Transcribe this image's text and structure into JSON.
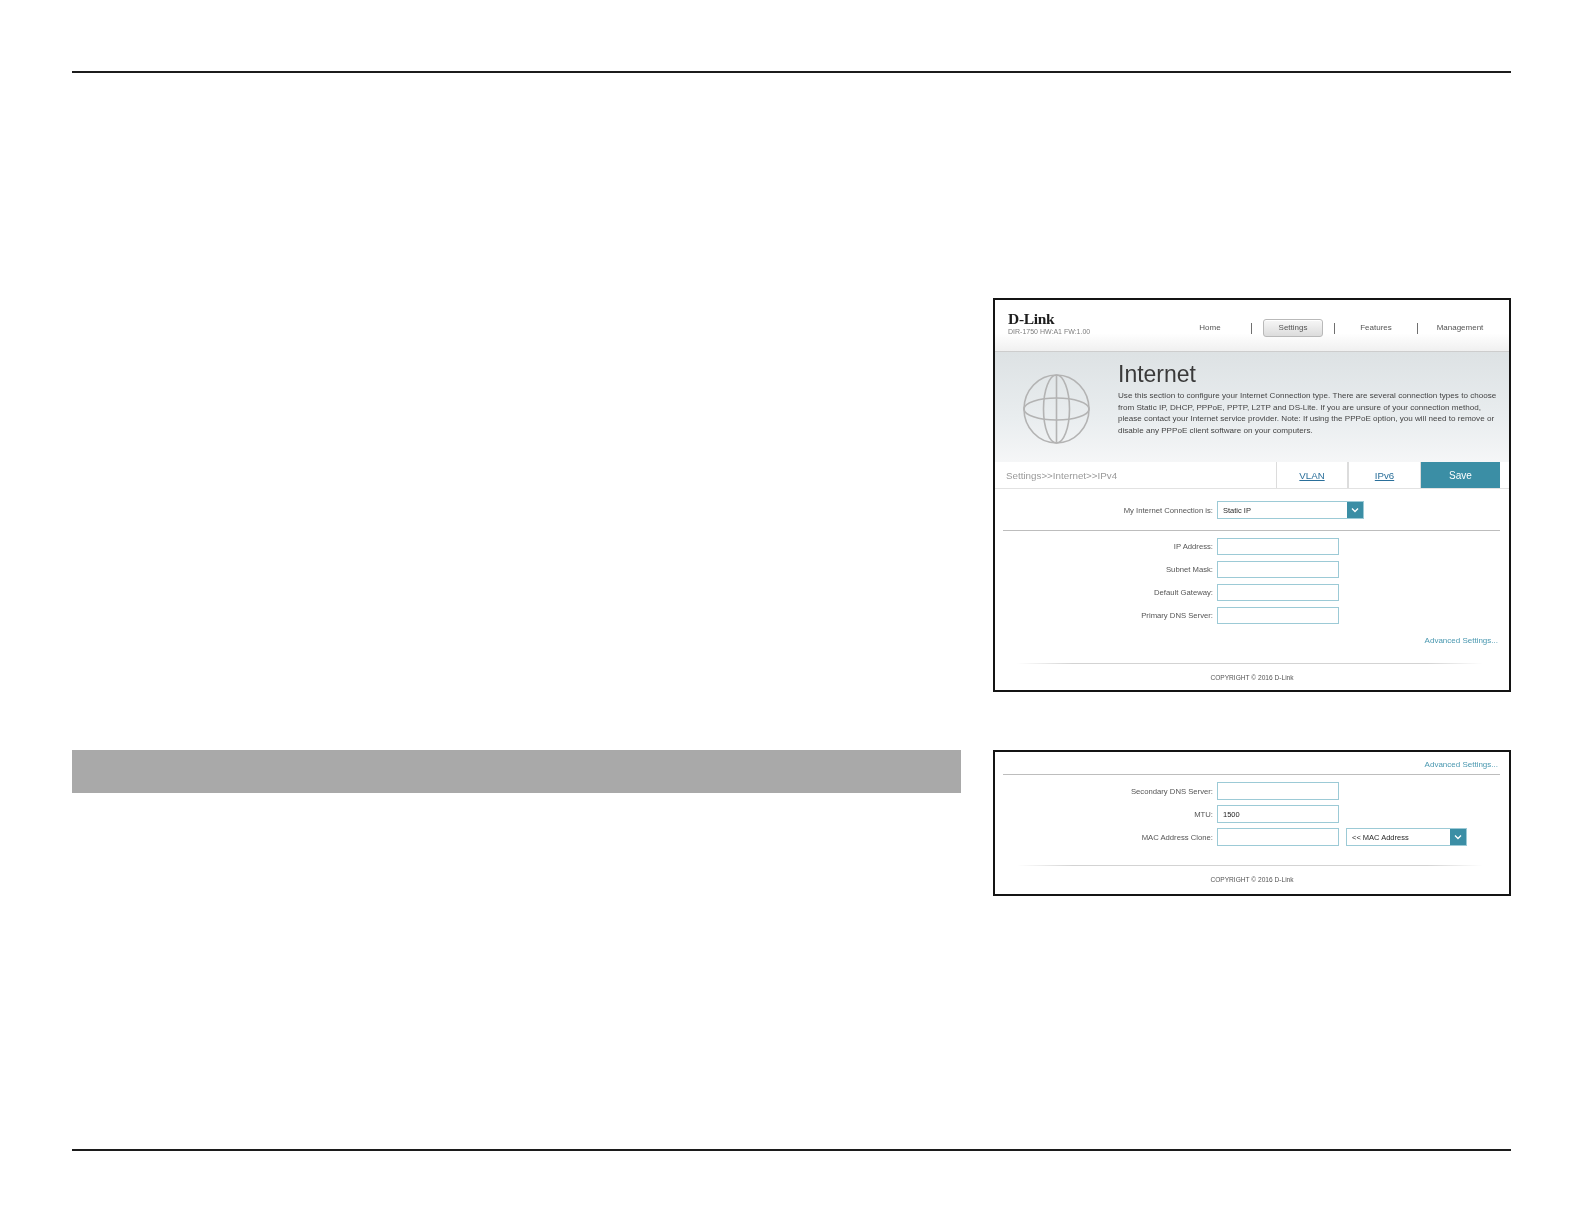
{
  "screenshot_1": {
    "logo": "D-Link",
    "model_info": "DIR-1750 HW:A1 FW:1.00",
    "nav": [
      {
        "label": "Home",
        "selected": false
      },
      {
        "label": "Settings",
        "selected": true
      },
      {
        "label": "Features",
        "selected": false
      },
      {
        "label": "Management",
        "selected": false
      }
    ],
    "banner": {
      "title": "Internet",
      "description": "Use this section to configure your Internet Connection type. There are several connection types to choose from Static IP, DHCP, PPPoE, PPTP, L2TP and DS-Lite. If you are unsure of your connection method,\nplease contact your Internet service provider. Note: If using the PPPoE option, you will need to remove or disable any PPPoE client software on your computers."
    },
    "breadcrumb": "Settings>>Internet>>IPv4",
    "actions": [
      {
        "label": "VLAN",
        "kind": "link"
      },
      {
        "label": "IPv6",
        "kind": "link"
      },
      {
        "label": "Save",
        "kind": "primary"
      }
    ],
    "connection": {
      "label": "My Internet Connection is:",
      "value": "Static IP"
    },
    "fields": [
      {
        "kind": "text",
        "label": "IP Address:"
      },
      {
        "kind": "text",
        "label": "Subnet Mask:"
      },
      {
        "kind": "text",
        "label": "Default Gateway:"
      },
      {
        "kind": "text",
        "label": "Primary DNS Server:"
      }
    ],
    "advanced_link": "Advanced Settings...",
    "copyright": "COPYRIGHT © 2016 D-Link"
  },
  "screenshot_2": {
    "advanced_link": "Advanced Settings...",
    "fields": [
      {
        "kind": "text",
        "label": "Secondary DNS Server:"
      },
      {
        "kind": "text",
        "label": "MTU:",
        "value": "1500"
      },
      {
        "kind": "text_with_select",
        "label": "MAC Address Clone:",
        "option": "<< MAC Address"
      }
    ],
    "copyright": "COPYRIGHT © 2016 D-Link"
  }
}
